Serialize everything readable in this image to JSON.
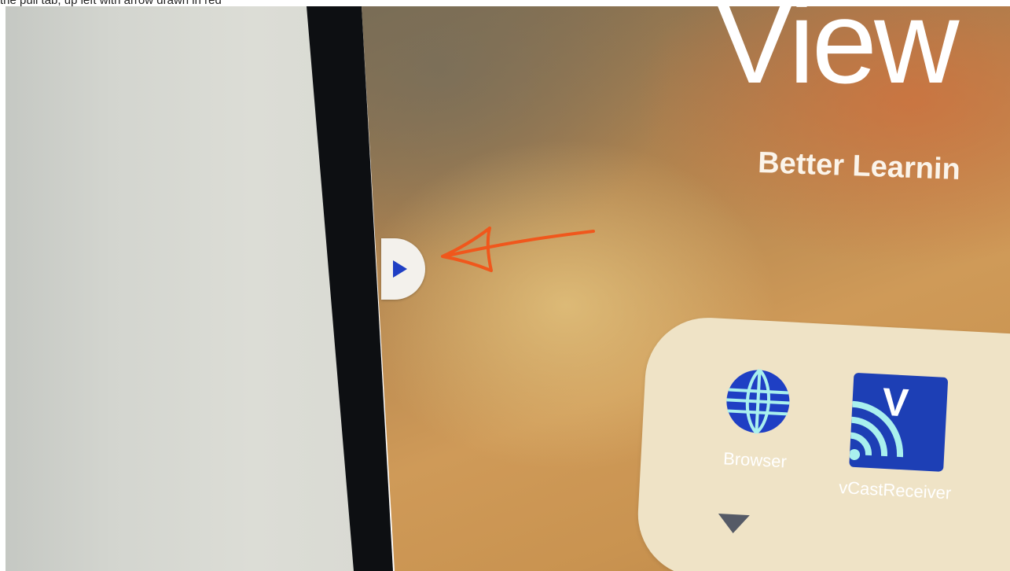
{
  "caption": "the pull tab, up left with arrow drawn in red",
  "screen": {
    "title": "View",
    "subtitle": "Better Learnin"
  },
  "side_tab": {
    "icon": "play-triangle-icon",
    "color": "#1f3fc4"
  },
  "annotation": {
    "icon": "hand-drawn-arrow",
    "color": "#f0571c"
  },
  "dock": {
    "apps": [
      {
        "label": "Browser",
        "icon": "globe-icon",
        "color": "#1f3fc4"
      },
      {
        "label": "vCastReceiver",
        "icon": "vcast-icon",
        "letter": "V",
        "color": "#1d3fb5"
      }
    ],
    "more_icon": "caret-down-icon"
  }
}
